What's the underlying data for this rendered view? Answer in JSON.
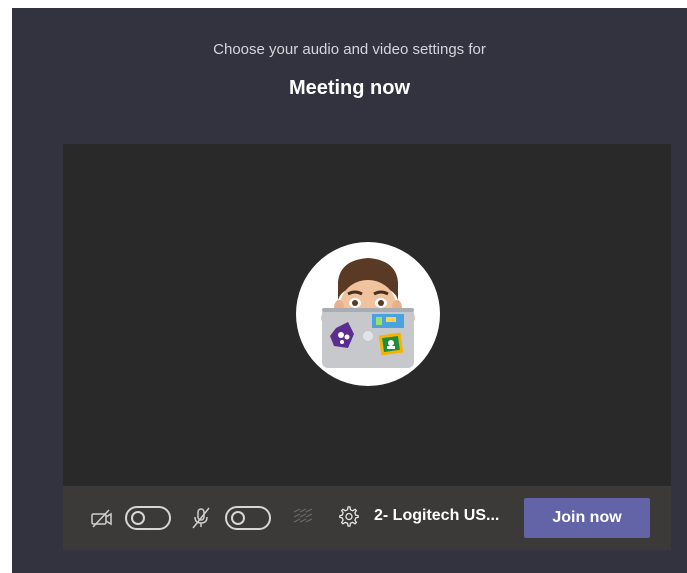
{
  "header": {
    "subtitle": "Choose your audio and video settings for",
    "meeting_title": "Meeting now"
  },
  "preview": {
    "avatar_icon": "memoji-avatar-with-laptop"
  },
  "controls": {
    "camera_icon": "camera-off-icon",
    "camera_toggle": "off",
    "microphone_icon": "microphone-off-icon",
    "microphone_toggle": "off",
    "background_effects_icon": "background-blur-icon",
    "device_settings_icon": "gear-icon",
    "device_label": "2- Logitech US...",
    "join_label": "Join now"
  },
  "colors": {
    "window_background": "#33333f",
    "preview_background": "#292929",
    "controls_background": "#3b3a39",
    "join_button": "#6264a7"
  }
}
